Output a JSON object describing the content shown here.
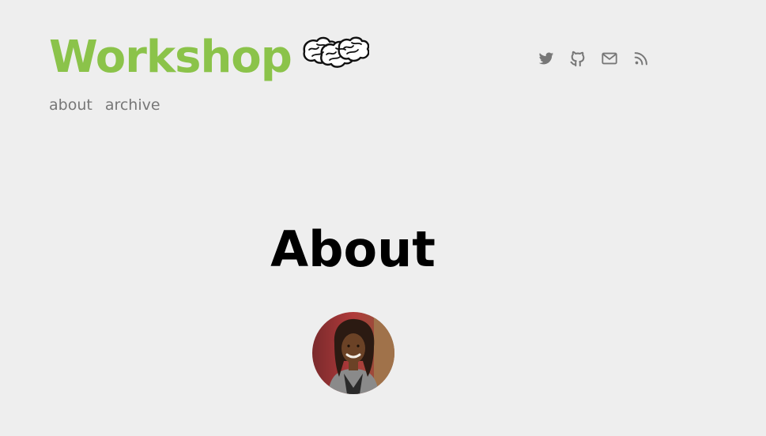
{
  "site": {
    "title": "Workshop",
    "title_color": "#8bc34a"
  },
  "nav": {
    "items": [
      {
        "label": "about"
      },
      {
        "label": "archive"
      }
    ]
  },
  "social": {
    "icons": [
      "twitter-icon",
      "github-icon",
      "mail-icon",
      "rss-icon"
    ],
    "icon_color": "#777777"
  },
  "main": {
    "heading": "About"
  }
}
